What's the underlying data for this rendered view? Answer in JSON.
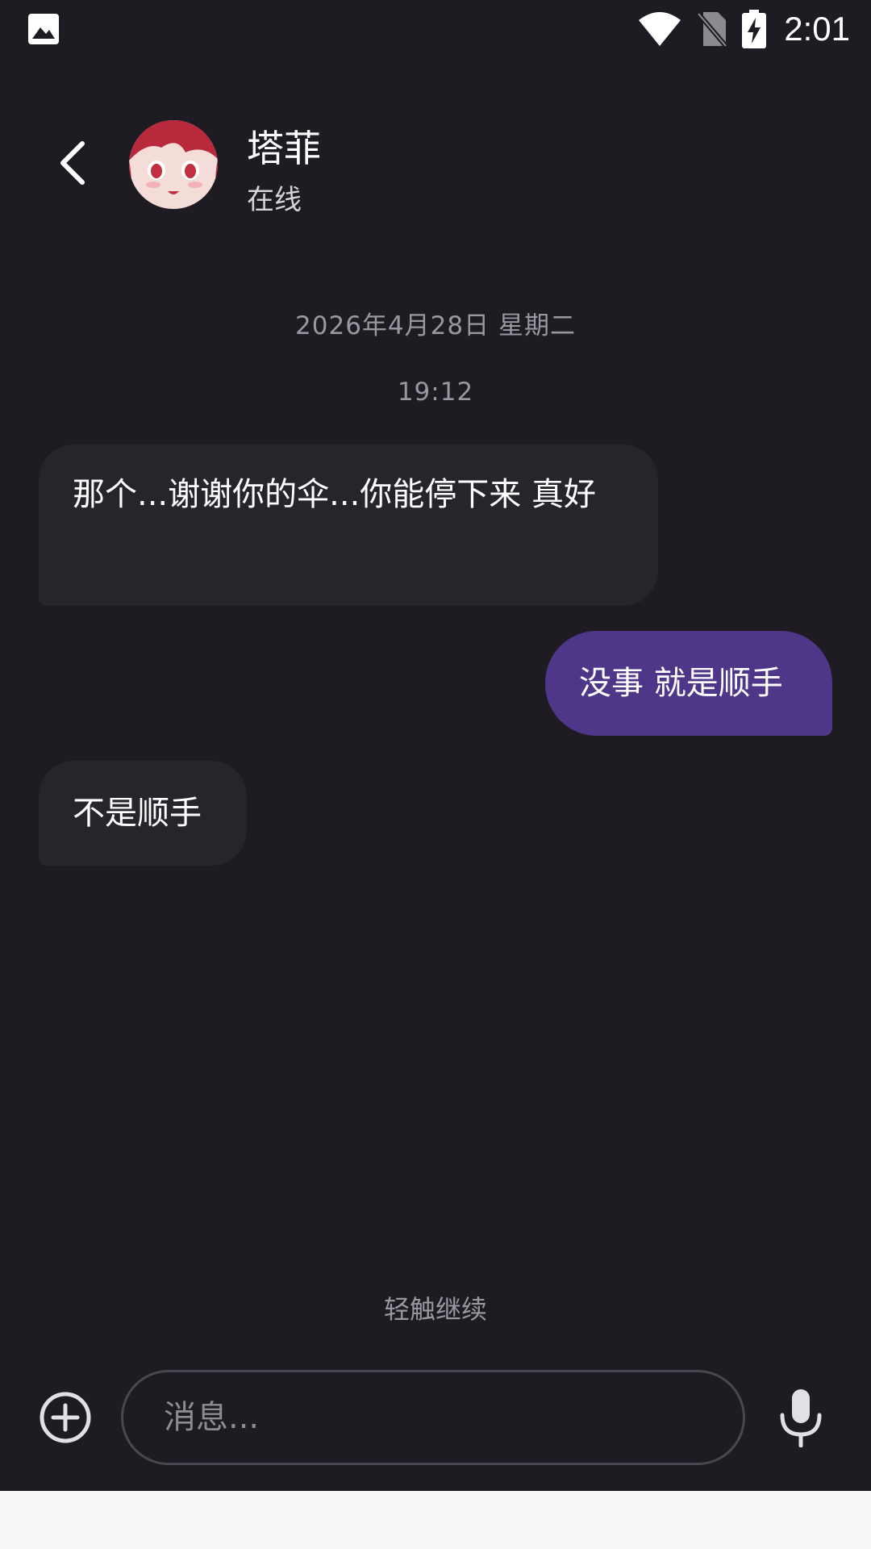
{
  "status_bar": {
    "time": "2:01",
    "icons": [
      "image-icon",
      "wifi-icon",
      "no-sim-icon",
      "battery-charging-icon"
    ]
  },
  "header": {
    "contact_name": "塔菲",
    "contact_status": "在线",
    "back_icon": "chevron-left-icon",
    "avatar_icon": "avatar"
  },
  "chat": {
    "date": "2026年4月28日 星期二",
    "time": "19:12",
    "messages": [
      {
        "direction": "incoming",
        "text": "那个...谢谢你的伞...你能停下来 真好"
      },
      {
        "direction": "outgoing",
        "text": "没事 就是顺手"
      },
      {
        "direction": "incoming",
        "text": "不是顺手"
      }
    ],
    "tap_hint": "轻触继续"
  },
  "composer": {
    "placeholder": "消息...",
    "value": "",
    "add_icon": "plus-circle-icon",
    "mic_icon": "microphone-icon"
  },
  "colors": {
    "background": "#1e1c22",
    "incoming_bubble": "#27252c",
    "outgoing_bubble": "#4e3689",
    "muted_text": "#9a97a0"
  }
}
